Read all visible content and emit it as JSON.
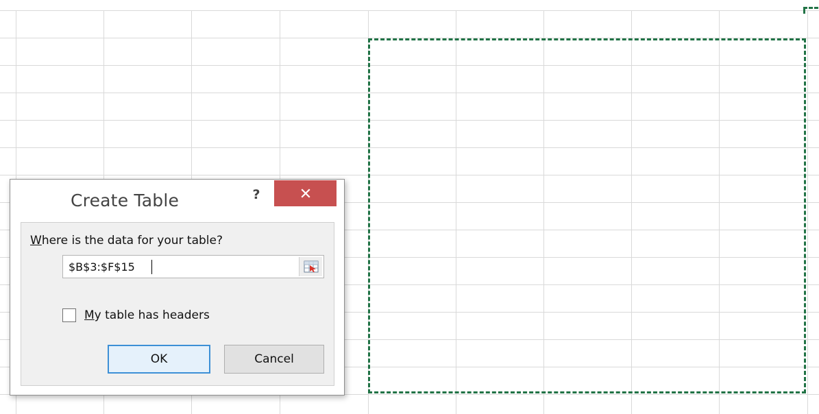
{
  "dialog": {
    "title": "Create Table",
    "help_label": "?",
    "close_icon": "close-icon",
    "prompt_prefix": "W",
    "prompt_rest": "here is the data for your table?",
    "range_value": "$B$3:$F$15",
    "range_picker_icon": "range-selector-icon",
    "checkbox_mnemonic": "M",
    "checkbox_rest": "y table has headers",
    "checkbox_checked": false,
    "ok_label": "OK",
    "cancel_label": "Cancel"
  },
  "colors": {
    "selection_marquee": "#217346",
    "close_button": "#c75050",
    "ok_border": "#3c8fd6"
  }
}
